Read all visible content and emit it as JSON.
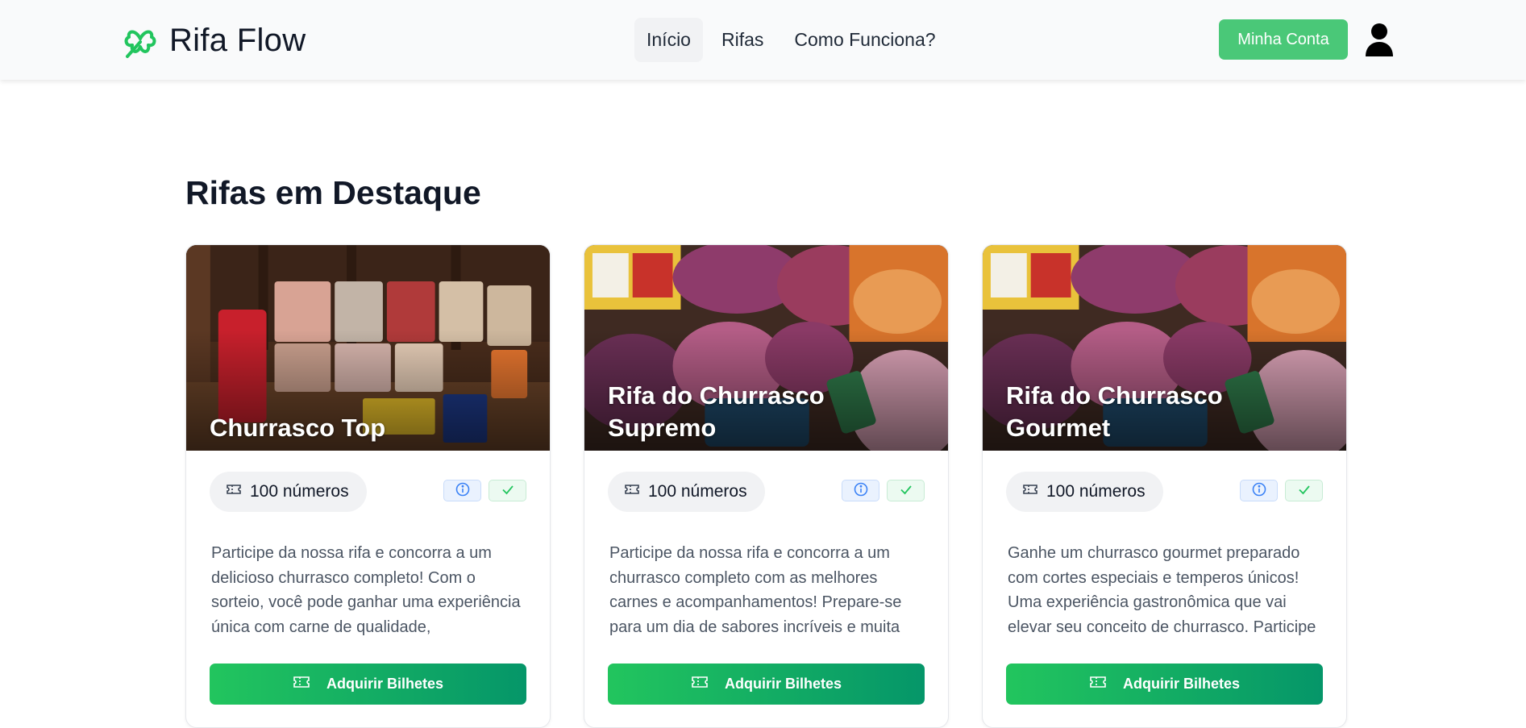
{
  "brand": {
    "name": "Rifa Flow",
    "logo_icon": "clover-icon",
    "accent": "#22c55e"
  },
  "nav": {
    "links": [
      {
        "label": "Início",
        "active": true
      },
      {
        "label": "Rifas",
        "active": false
      },
      {
        "label": "Como Funciona?",
        "active": false
      }
    ],
    "account_button": "Minha Conta",
    "user_icon": "user-icon"
  },
  "main": {
    "section_title": "Rifas em Destaque",
    "cards": [
      {
        "title": "Churrasco Top",
        "numbers_label": "100 números",
        "description": "Participe da nossa rifa e concorra a um delicioso churrasco completo! Com o sorteio, você pode ganhar uma experiência única com carne de qualidade,",
        "cta": "Adquirir Bilhetes"
      },
      {
        "title": "Rifa do Churrasco Supremo",
        "numbers_label": "100 números",
        "description": "Participe da nossa rifa e concorra a um churrasco completo com as melhores carnes e acompanhamentos! Prepare-se para um dia de sabores incríveis e muita",
        "cta": "Adquirir Bilhetes"
      },
      {
        "title": "Rifa do Churrasco Gourmet",
        "numbers_label": "100 números",
        "description": "Ganhe um churrasco gourmet preparado com cortes especiais e temperos únicos! Uma experiência gastronômica que vai elevar seu conceito de churrasco. Participe",
        "cta": "Adquirir Bilhetes"
      }
    ]
  }
}
